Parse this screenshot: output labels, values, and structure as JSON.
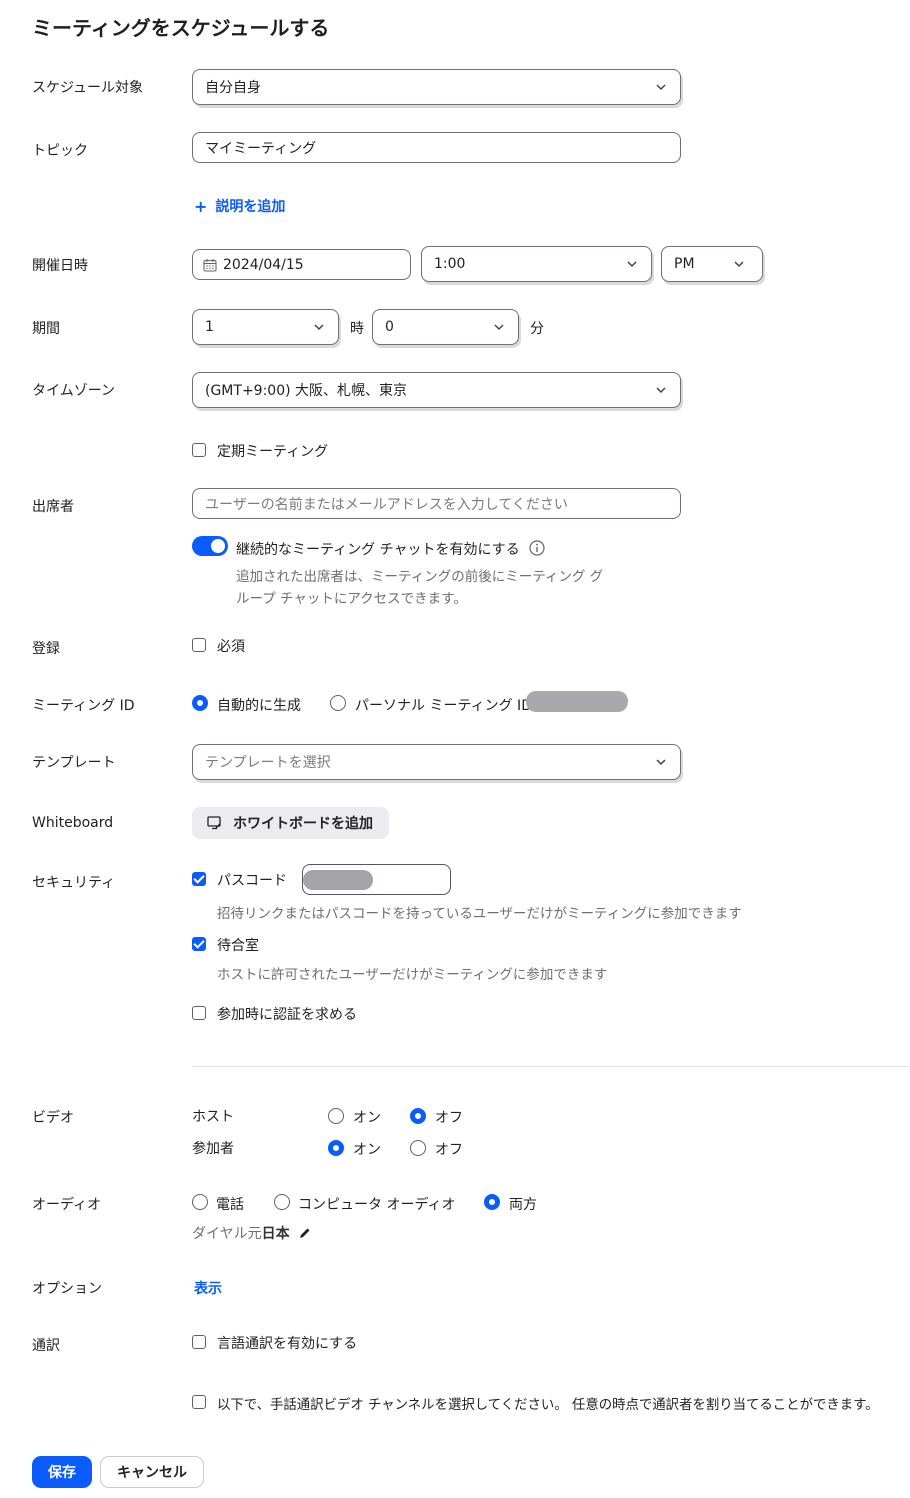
{
  "page_title": "ミーティングをスケジュールする",
  "schedule_for": {
    "label": "スケジュール対象",
    "value": "自分自身"
  },
  "topic": {
    "label": "トピック",
    "value": "マイミーティング"
  },
  "add_description": "説明を追加",
  "datetime": {
    "label": "開催日時",
    "date": "2024/04/15",
    "time": "1:00",
    "ampm": "PM"
  },
  "duration": {
    "label": "期間",
    "hours": "1",
    "hours_unit": "時",
    "minutes": "0",
    "minutes_unit": "分"
  },
  "timezone": {
    "label": "タイムゾーン",
    "value": "(GMT+9:00) 大阪、札幌、東京"
  },
  "recurring": {
    "label": "定期ミーティング",
    "checked": false
  },
  "attendees": {
    "label": "出席者",
    "placeholder": "ユーザーの名前またはメールアドレスを入力してください",
    "chat_toggle_label": "継続的なミーティング チャットを有効にする",
    "chat_toggle_on": true,
    "chat_help_line1": "追加された出席者は、ミーティングの前後にミーティング グ",
    "chat_help_line2": "ループ チャットにアクセスできます。"
  },
  "registration": {
    "label": "登録",
    "required_label": "必須",
    "checked": false
  },
  "meeting_id": {
    "label": "ミーティング ID",
    "auto_label": "自動的に生成",
    "personal_label": "パーソナル ミーティング ID",
    "selected": "auto"
  },
  "template": {
    "label": "テンプレート",
    "placeholder": "テンプレートを選択"
  },
  "whiteboard": {
    "label": "Whiteboard",
    "button": "ホワイトボードを追加"
  },
  "security": {
    "label": "セキュリティ",
    "passcode_label": "パスコード",
    "passcode_checked": true,
    "passcode_help": "招待リンクまたはパスコードを持っているユーザーだけがミーティングに参加できます",
    "waiting_room_label": "待合室",
    "waiting_room_checked": true,
    "waiting_room_help": "ホストに許可されたユーザーだけがミーティングに参加できます",
    "auth_label": "参加時に認証を求める",
    "auth_checked": false
  },
  "video": {
    "label": "ビデオ",
    "host_label": "ホスト",
    "participant_label": "参加者",
    "on": "オン",
    "off": "オフ",
    "host_value": "off",
    "participant_value": "on"
  },
  "audio": {
    "label": "オーディオ",
    "phone": "電話",
    "computer": "コンピュータ オーディオ",
    "both": "両方",
    "selected": "both",
    "dial_from_prefix": "ダイヤル元",
    "dial_from_country": "日本"
  },
  "options": {
    "label": "オプション",
    "show": "表示"
  },
  "interpretation": {
    "label": "通訳",
    "language_label": "言語通訳を有効にする",
    "sign_label": "以下で、手話通訳ビデオ チャンネルを選択してください。 任意の時点で通訳者を割り当てることができます。"
  },
  "buttons": {
    "save": "保存",
    "cancel": "キャンセル"
  },
  "colors": {
    "accent": "#0b5cff",
    "border": "#6e6e7a",
    "help_text": "#6e6e77"
  }
}
